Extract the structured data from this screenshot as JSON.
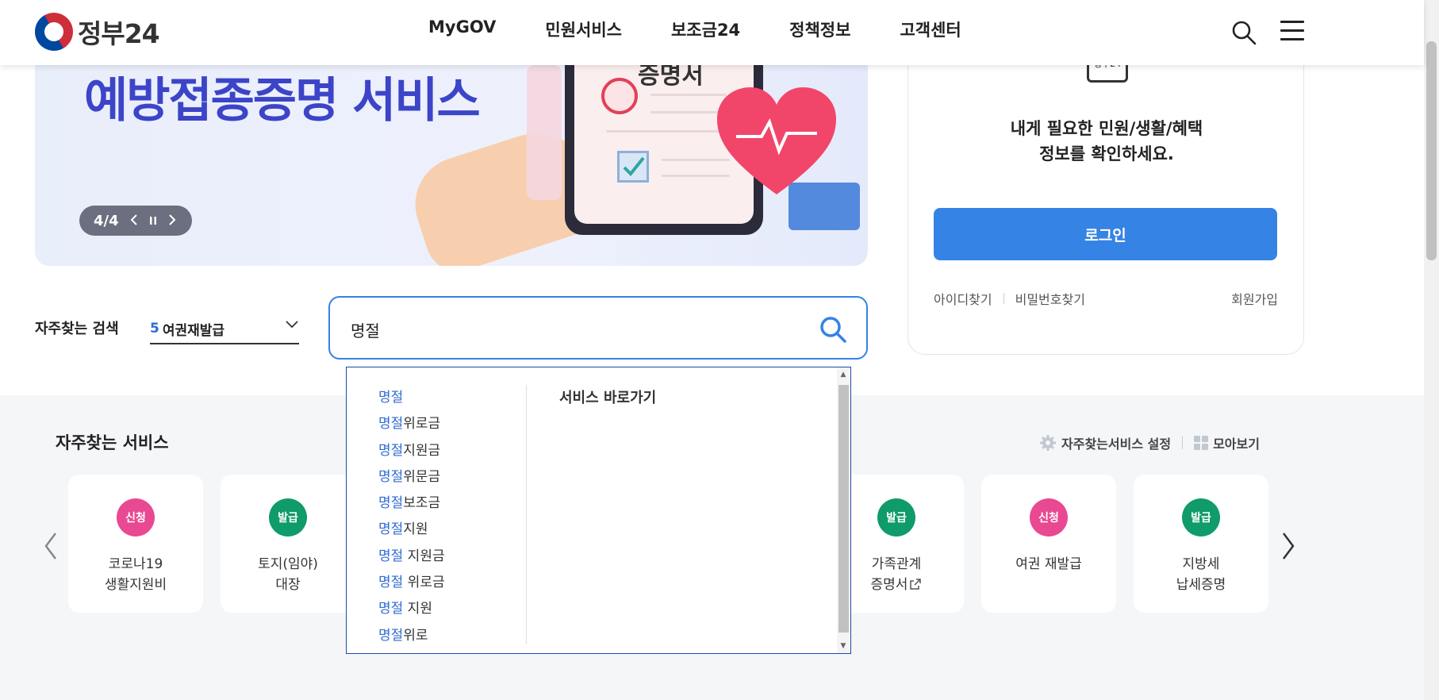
{
  "header": {
    "logo_text": "정부24",
    "nav": [
      "MyGOV",
      "민원서비스",
      "보조금24",
      "정책정보",
      "고객센터"
    ]
  },
  "banner": {
    "title": "예방접종증명 서비스",
    "cert_label": "증명서",
    "pager": "4/4"
  },
  "login": {
    "icon_label": "정부24",
    "message_line1": "내게 필요한 민원/생활/혜택",
    "message_line2": "정보를 확인하세요.",
    "button": "로그인",
    "find_id": "아이디찾기",
    "find_pw": "비밀번호찾기",
    "signup": "회원가입"
  },
  "frequent_search": {
    "label": "자주찾는 검색",
    "rank": "5",
    "keyword": "여권재발급"
  },
  "search": {
    "value": "명절"
  },
  "autocomplete": {
    "suggestions": [
      {
        "hl": "명절",
        "rest": ""
      },
      {
        "hl": "명절",
        "rest": "위로금"
      },
      {
        "hl": "명절",
        "rest": "지원금"
      },
      {
        "hl": "명절",
        "rest": "위문금"
      },
      {
        "hl": "명절",
        "rest": "보조금"
      },
      {
        "hl": "명절",
        "rest": "지원"
      },
      {
        "hl": "명절",
        "rest": " 지원금"
      },
      {
        "hl": "명절",
        "rest": " 위로금"
      },
      {
        "hl": "명절",
        "rest": " 지원"
      },
      {
        "hl": "명절",
        "rest": "위로"
      }
    ],
    "service_title": "서비스 바로가기"
  },
  "services": {
    "title": "자주찾는 서비스",
    "settings": "자주찾는서비스 설정",
    "view_all": "모아보기",
    "cards": [
      {
        "badge": "신청",
        "type": "apply",
        "line1": "코로나19",
        "line2": "생활지원비"
      },
      {
        "badge": "발급",
        "type": "issue",
        "line1": "토지(임야)",
        "line2": "대장"
      },
      {
        "badge": "발급",
        "type": "issue",
        "line1": "가족관계",
        "line2": "증명서"
      },
      {
        "badge": "신청",
        "type": "apply",
        "line1": "여권 재발급",
        "line2": ""
      },
      {
        "badge": "발급",
        "type": "issue",
        "line1": "지방세",
        "line2": "납세증명"
      }
    ]
  },
  "colors": {
    "accent": "#3583e4",
    "highlight": "#2f6bd4",
    "apply_badge": "#e94892",
    "issue_badge": "#0f9b6a"
  }
}
